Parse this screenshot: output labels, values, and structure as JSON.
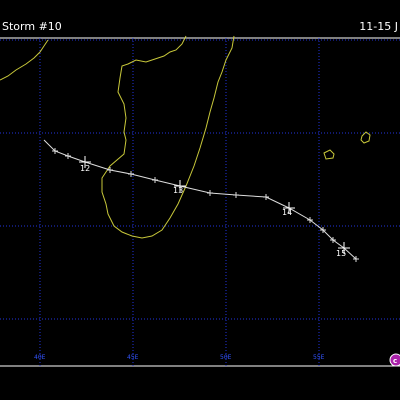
{
  "header": {
    "left_title": "Storm #10",
    "right_title": "11-15 J"
  },
  "map": {
    "colors": {
      "background": "#000000",
      "grid": "#2233dd",
      "coast": "#c8c83a",
      "track": "#dddddd",
      "border": "#ffffff",
      "logo": "#aa22aa"
    },
    "longitude_labels": [
      "40E",
      "45E",
      "50E",
      "55E"
    ],
    "day_labels": [
      "12",
      "13",
      "14",
      "15"
    ],
    "logo_icon": "copyright-logo-icon"
  }
}
